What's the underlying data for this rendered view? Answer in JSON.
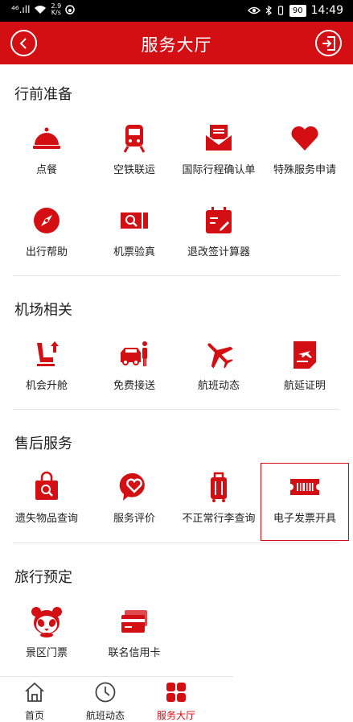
{
  "status_bar": {
    "signal": "⁴⁶.ıll",
    "net_speed_value": "2.9",
    "net_speed_unit": "K/s",
    "battery": "90",
    "time": "14:49"
  },
  "header": {
    "title": "服务大厅"
  },
  "sections": [
    {
      "title": "行前准备",
      "items": [
        {
          "label": "点餐",
          "icon": "cloche-icon"
        },
        {
          "label": "空铁联运",
          "icon": "train-icon"
        },
        {
          "label": "国际行程确认单",
          "icon": "envelope-icon"
        },
        {
          "label": "特殊服务申请",
          "icon": "heart-icon"
        },
        {
          "label": "出行帮助",
          "icon": "compass-icon"
        },
        {
          "label": "机票验真",
          "icon": "ticket-search-icon"
        },
        {
          "label": "退改签计算器",
          "icon": "calendar-edit-icon"
        }
      ]
    },
    {
      "title": "机场相关",
      "items": [
        {
          "label": "机会升舱",
          "icon": "seat-upgrade-icon"
        },
        {
          "label": "免费接送",
          "icon": "car-person-icon"
        },
        {
          "label": "航班动态",
          "icon": "airplane-icon"
        },
        {
          "label": "航延证明",
          "icon": "delay-certificate-icon"
        }
      ]
    },
    {
      "title": "售后服务",
      "items": [
        {
          "label": "遗失物品查询",
          "icon": "lost-bag-icon"
        },
        {
          "label": "服务评价",
          "icon": "chat-heart-icon"
        },
        {
          "label": "不正常行李查询",
          "icon": "luggage-icon"
        },
        {
          "label": "电子发票开具",
          "icon": "invoice-ticket-icon"
        }
      ]
    },
    {
      "title": "旅行预定",
      "items": [
        {
          "label": "景区门票",
          "icon": "panda-icon"
        },
        {
          "label": "联名信用卡",
          "icon": "credit-card-icon"
        }
      ]
    }
  ],
  "tabbar": {
    "tabs": [
      {
        "label": "首页",
        "icon": "home-icon"
      },
      {
        "label": "航班动态",
        "icon": "clock-icon"
      },
      {
        "label": "服务大厅",
        "icon": "grid-icon",
        "active": true
      }
    ]
  },
  "colors": {
    "brand": "#d40f14",
    "divider": "#e4e4e4"
  }
}
